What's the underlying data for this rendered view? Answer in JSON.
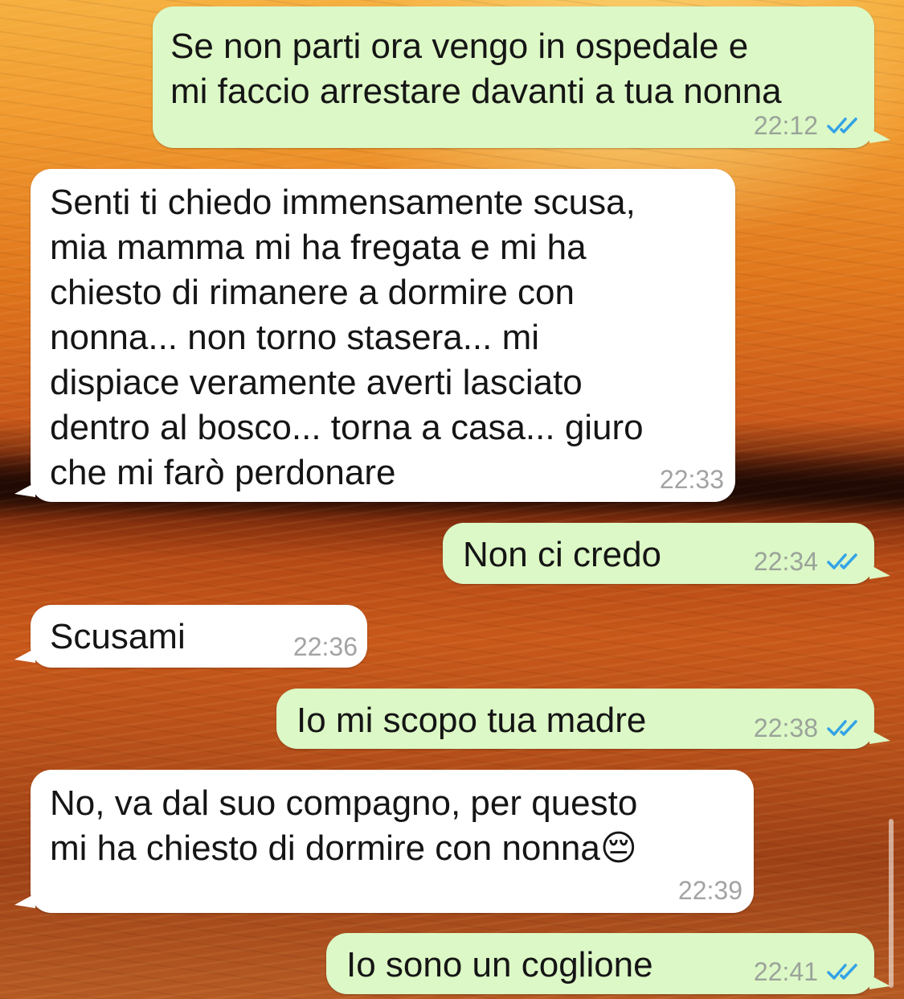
{
  "colors": {
    "outgoing_bubble": "#dcf8c6",
    "incoming_bubble": "#ffffff",
    "read_check": "#34a3e6",
    "timestamp": "#9aa39a"
  },
  "messages": [
    {
      "direction": "outgoing",
      "text": "Se non parti ora vengo in ospedale e\nmi faccio arrestare davanti a tua nonna",
      "time": "22:12",
      "status_icon": "double-check-read-icon"
    },
    {
      "direction": "incoming",
      "text": "Senti ti chiedo immensamente scusa,\nmia mamma mi ha fregata e mi ha\nchiesto di rimanere a dormire con\nnonna... non torno stasera... mi\ndispiace veramente averti lasciato\ndentro al bosco... torna a casa... giuro\nche mi farò perdonare",
      "time": "22:33"
    },
    {
      "direction": "outgoing",
      "text": "Non ci credo",
      "time": "22:34",
      "status_icon": "double-check-read-icon"
    },
    {
      "direction": "incoming",
      "text": "Scusami",
      "time": "22:36"
    },
    {
      "direction": "outgoing",
      "text": "Io mi scopo tua madre",
      "time": "22:38",
      "status_icon": "double-check-read-icon"
    },
    {
      "direction": "incoming",
      "text": "No, va dal suo compagno, per questo\nmi ha chiesto di dormire con nonna",
      "emoji": "😔",
      "time": "22:39"
    },
    {
      "direction": "outgoing",
      "text": "Io sono un coglione",
      "time": "22:41",
      "status_icon": "double-check-read-icon"
    }
  ]
}
